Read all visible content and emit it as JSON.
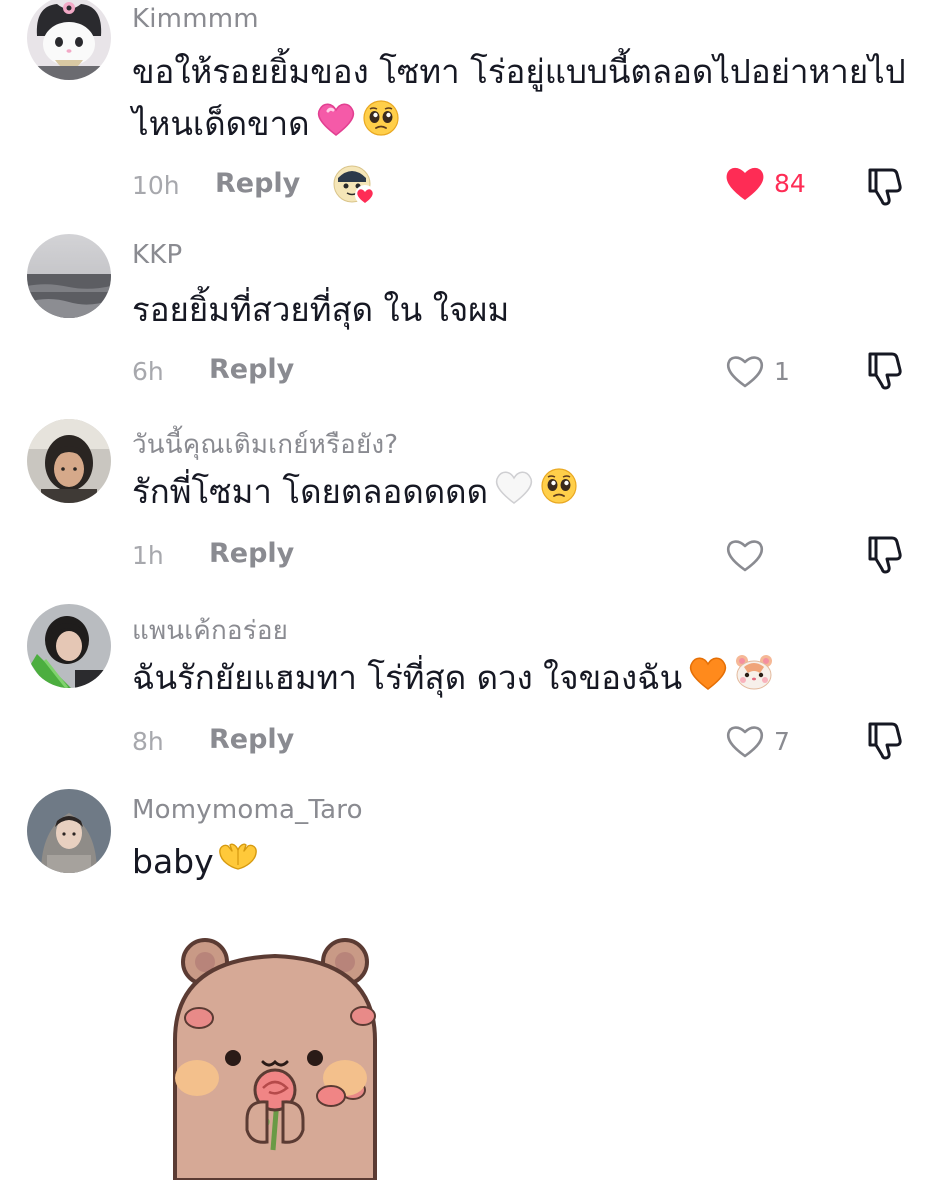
{
  "comments": [
    {
      "username": "Kimmmm",
      "text_line1": "ขอให้รอยยิ้มของ โซทา โร่อยู่แบบนี้ตลอดไปอย่าหายไป",
      "text_line2": "ไหนเด็ดขาด",
      "emojis": [
        "pink-heart",
        "pleading-face"
      ],
      "time": "10h",
      "reply_label": "Reply",
      "likes": "84",
      "liked": true,
      "creator_liked": true
    },
    {
      "username": "KKP",
      "text_line1": "รอยยิ้มที่สวยที่สุด ใน ใจผม",
      "time": "6h",
      "reply_label": "Reply",
      "likes": "1",
      "liked": false
    },
    {
      "username": "วันนี้คุณเติมเกย์หรือยัง?",
      "text_line1": "รักพี่โซมา โดยตลอดดดด",
      "emojis": [
        "white-heart",
        "pleading-face"
      ],
      "time": "1h",
      "reply_label": "Reply",
      "likes": "",
      "liked": false
    },
    {
      "username": "แพนเค้กอร่อย",
      "text_line1": "ฉันรักยัยแฮมทา โร่ที่สุด ดวง ใจของฉัน",
      "emojis": [
        "orange-heart",
        "hamster-face"
      ],
      "time": "8h",
      "reply_label": "Reply",
      "likes": "7",
      "liked": false
    },
    {
      "username": "Momymoma_Taro",
      "text_line1": "baby",
      "emojis": [
        "heart-hands"
      ],
      "sticker": "bear-holding-rose"
    }
  ],
  "colors": {
    "accent_like": "#fe2c55",
    "meta_gray": "#8a8b91",
    "text": "#161823"
  }
}
